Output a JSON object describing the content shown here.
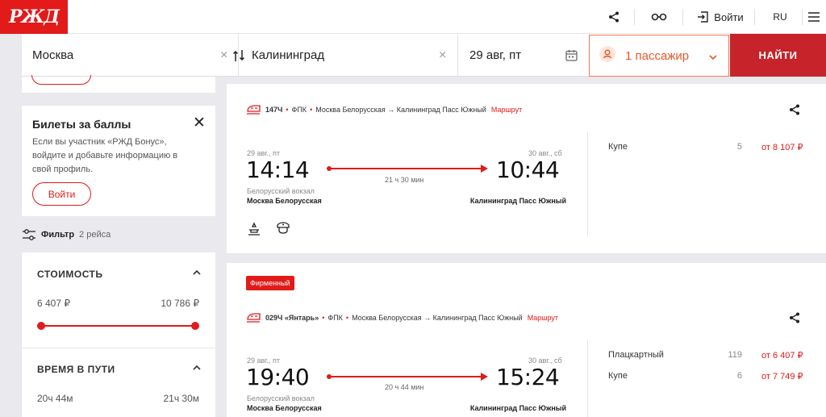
{
  "header": {
    "logo": "РЖД",
    "login": "Войти",
    "lang": "RU"
  },
  "search": {
    "from": "Москва",
    "to": "Калининград",
    "date": "29 авг, пт",
    "passengers": "1 пассажир",
    "find": "НАЙТИ"
  },
  "sidebar": {
    "bonus": {
      "title": "Билеты за баллы",
      "text": "Если вы участник «РЖД Бонус», войдите и добавьте информацию в свой профиль.",
      "login": "Войти"
    },
    "filter": {
      "label": "Фильтр",
      "count": "2 рейса"
    },
    "price": {
      "title": "СТОИМОСТЬ",
      "min": "6 407 ₽",
      "max": "10 786 ₽",
      "range_low": 0,
      "range_high": 1
    },
    "travel_time": {
      "title": "ВРЕМЯ В ПУТИ",
      "min": "20ч 44м",
      "max": "21ч 30м"
    }
  },
  "trains": [
    {
      "badge": "",
      "number": "147Ч",
      "carrier": "ФПК",
      "route_text": "Москва Белорусская → Калининград Пасс Южный",
      "route_link": "Маршрут",
      "dep_date": "29 авг., пт",
      "dep_time": "14:14",
      "arr_date": "30 авг., сб",
      "arr_time": "10:44",
      "duration": "21 ч 30 мин",
      "dep_station_small": "Белорусский вокзал",
      "dep_station": "Москва Белорусская",
      "arr_station": "Калининград Пасс Южный",
      "classes": [
        {
          "name": "Купе",
          "seats": "5",
          "price": "от 8 107 ₽"
        }
      ]
    },
    {
      "badge": "Фирменный",
      "number": "029Ч «Янтарь»",
      "carrier": "ФПК",
      "route_text": "Москва Белорусская → Калининград Пасс Южный",
      "route_link": "Маршрут",
      "dep_date": "29 авг., пт",
      "dep_time": "19:40",
      "arr_date": "30 авг., сб",
      "arr_time": "15:24",
      "duration": "20 ч 44 мин",
      "dep_station_small": "Белорусский вокзал",
      "dep_station": "Москва Белорусская",
      "arr_station": "Калининград Пасс Южный",
      "classes": [
        {
          "name": "Плацкартный",
          "seats": "119",
          "price": "от 6 407 ₽"
        },
        {
          "name": "Купе",
          "seats": "6",
          "price": "от 7 749 ₽"
        }
      ]
    }
  ]
}
